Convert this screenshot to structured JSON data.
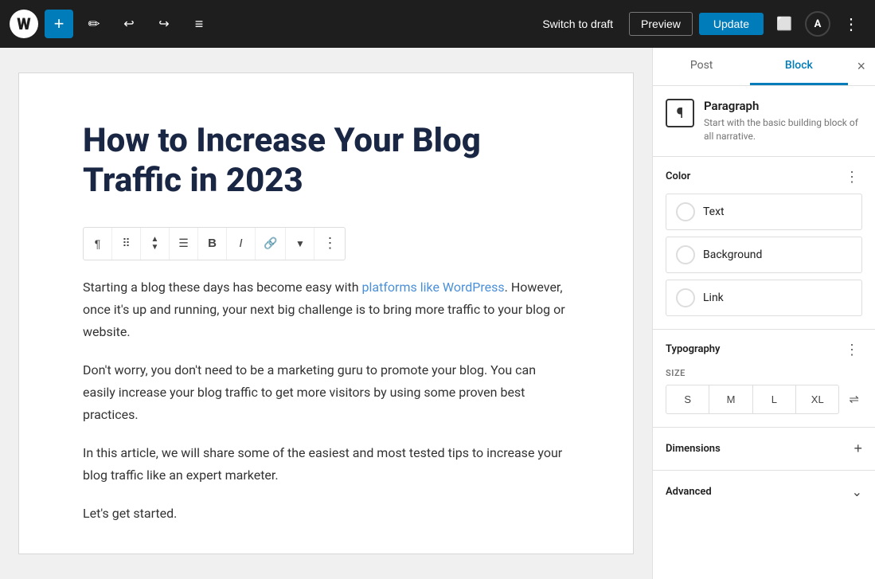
{
  "toolbar": {
    "add_label": "+",
    "wp_logo": "W",
    "pencil_icon": "✏",
    "undo_icon": "↩",
    "redo_icon": "↪",
    "list_icon": "≡",
    "switch_draft_label": "Switch to draft",
    "preview_label": "Preview",
    "update_label": "Update",
    "layout_icon": "⬜",
    "astra_label": "A",
    "more_icon": "⋮"
  },
  "editor": {
    "title": "How to Increase Your Blog Traffic in 2023",
    "paragraphs": [
      "Starting a blog these days has become easy with platforms like WordPress. However, once it's up and running, your next big challenge is to bring more traffic to your blog or website.",
      "Don't worry, you don't need to be a marketing guru to promote your blog. You can easily increase your blog traffic to get more visitors by using some proven best practices.",
      "In this article, we will share some of the easiest and most tested tips to increase your blog traffic like an expert marketer.",
      "Let's get started."
    ],
    "block_toolbar": {
      "paragraph_icon": "¶",
      "drag_icon": "⠿",
      "move_up_icon": "▲",
      "move_down_icon": "▼",
      "align_icon": "☰",
      "bold_icon": "B",
      "italic_icon": "I",
      "link_icon": "🔗",
      "more_options_icon": "⋮"
    }
  },
  "sidebar": {
    "tabs": [
      {
        "id": "post",
        "label": "Post",
        "active": false
      },
      {
        "id": "block",
        "label": "Block",
        "active": true
      }
    ],
    "close_icon": "×",
    "block_info": {
      "icon": "¶",
      "name": "Paragraph",
      "description": "Start with the basic building block of all narrative."
    },
    "color_section": {
      "title": "Color",
      "more_icon": "⋮",
      "options": [
        {
          "id": "text",
          "label": "Text"
        },
        {
          "id": "background",
          "label": "Background"
        },
        {
          "id": "link",
          "label": "Link"
        }
      ]
    },
    "typography_section": {
      "title": "Typography",
      "more_icon": "⋮",
      "size_label": "SIZE",
      "filter_icon": "⇌",
      "sizes": [
        "S",
        "M",
        "L",
        "XL"
      ]
    },
    "dimensions_section": {
      "title": "Dimensions",
      "expand_icon": "+"
    },
    "advanced_section": {
      "title": "Advanced",
      "chevron_icon": "⌄"
    }
  }
}
